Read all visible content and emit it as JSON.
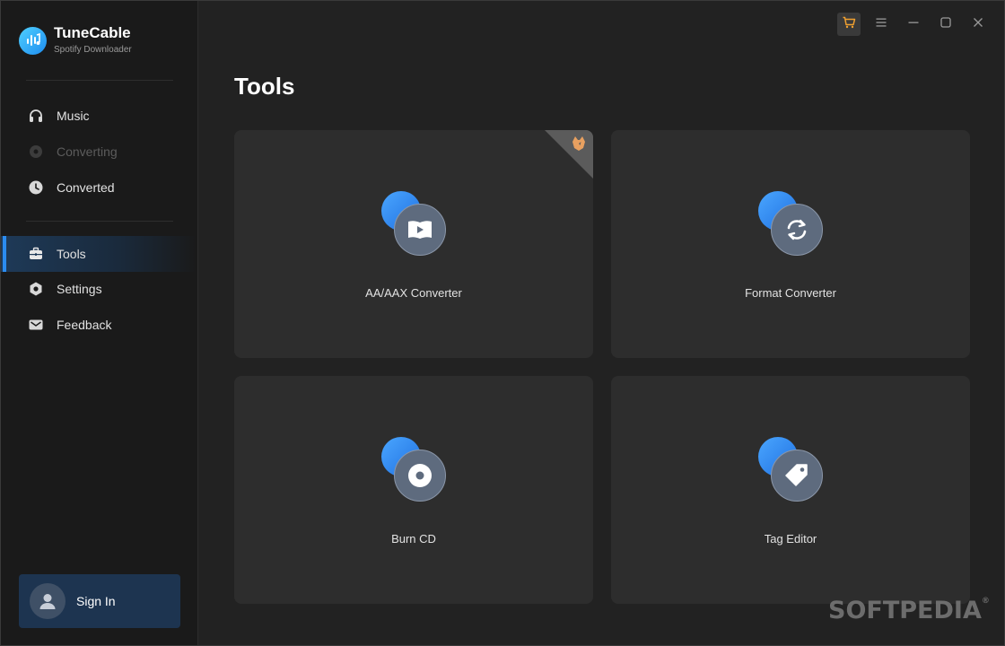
{
  "app": {
    "name": "TuneCable",
    "subtitle": "Spotify Downloader"
  },
  "sidebar": {
    "items": [
      {
        "label": "Music",
        "icon": "headphones-icon",
        "state": "normal"
      },
      {
        "label": "Converting",
        "icon": "disc-icon",
        "state": "disabled"
      },
      {
        "label": "Converted",
        "icon": "clock-icon",
        "state": "normal"
      },
      {
        "label": "Tools",
        "icon": "toolbox-icon",
        "state": "active"
      },
      {
        "label": "Settings",
        "icon": "gear-icon",
        "state": "normal"
      },
      {
        "label": "Feedback",
        "icon": "mail-icon",
        "state": "normal"
      }
    ],
    "sign_in_label": "Sign In"
  },
  "titlebar": {
    "buttons": [
      "cart-icon",
      "menu-icon",
      "minimize-icon",
      "maximize-icon",
      "close-icon"
    ]
  },
  "main": {
    "title": "Tools",
    "cards": [
      {
        "label": "AA/AAX Converter",
        "icon": "audiobook-play-icon",
        "badge": "fox-badge-icon"
      },
      {
        "label": "Format Converter",
        "icon": "refresh-icon"
      },
      {
        "label": "Burn CD",
        "icon": "cd-icon"
      },
      {
        "label": "Tag Editor",
        "icon": "tag-icon"
      }
    ]
  },
  "watermark": "SOFTPEDIA",
  "colors": {
    "accent": "#2b8cf0",
    "sidebar_bg": "#1a1a1a",
    "main_bg": "#222222",
    "card_bg": "#2d2d2d",
    "signin_bg": "#1d3450",
    "cart_orange": "#f0a030"
  }
}
